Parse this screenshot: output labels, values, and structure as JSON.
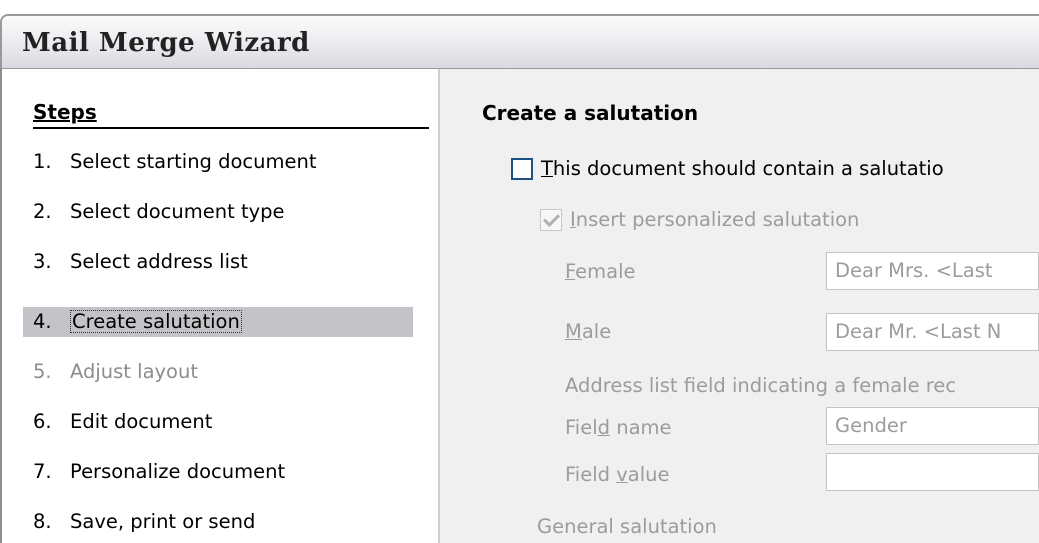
{
  "window": {
    "title": "Mail Merge Wizard"
  },
  "steps": {
    "heading": "Steps",
    "items": [
      {
        "num": "1.",
        "label": "Select starting document"
      },
      {
        "num": "2.",
        "label": "Select document type"
      },
      {
        "num": "3.",
        "label": "Select address list"
      },
      {
        "num": "4.",
        "label": "Create salutation"
      },
      {
        "num": "5.",
        "label": "Adjust layout"
      },
      {
        "num": "6.",
        "label": "Edit document"
      },
      {
        "num": "7.",
        "label": "Personalize document"
      },
      {
        "num": "8.",
        "label": "Save, print or send"
      }
    ]
  },
  "content": {
    "heading": "Create a salutation",
    "contain_salutation": {
      "pre": "",
      "key": "T",
      "post": "his document should contain a salutatio",
      "checked": false
    },
    "personalized": {
      "pre": "",
      "key": "I",
      "post": "nsert personalized salutation",
      "checked": true
    },
    "female": {
      "pre": "",
      "key": "F",
      "post": "emale",
      "value": "Dear Mrs. <Last"
    },
    "male": {
      "pre": "",
      "key": "M",
      "post": "ale",
      "value": "Dear Mr. <Last N"
    },
    "address_field_label": "Address list field indicating a female rec",
    "field_name": {
      "pre": "Fiel",
      "key": "d",
      "post": " name",
      "value": "Gender"
    },
    "field_value": {
      "pre": "Field ",
      "key": "v",
      "post": "alue",
      "value": ""
    },
    "general_salutation": "General salutation"
  }
}
